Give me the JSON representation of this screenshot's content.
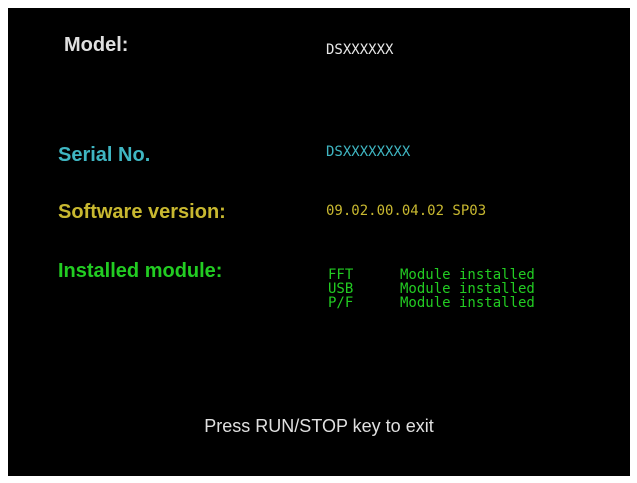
{
  "info": {
    "model_label": "Model:",
    "model_value": "DSXXXXXX",
    "serial_label": "Serial No.",
    "serial_value": "DSXXXXXXXX",
    "software_label": "Software version:",
    "software_value": "09.02.00.04.02 SP03",
    "modules_label": "Installed module:"
  },
  "modules": [
    {
      "name": "FFT",
      "status": "Module installed"
    },
    {
      "name": "USB",
      "status": "Module installed"
    },
    {
      "name": "P/F",
      "status": "Module installed"
    }
  ],
  "footer": {
    "hint": "Press RUN/STOP key to exit"
  },
  "colors": {
    "background": "#000000",
    "model": "#e0e0e0",
    "serial": "#3fb6c2",
    "software": "#c8b830",
    "modules": "#22cc22"
  }
}
